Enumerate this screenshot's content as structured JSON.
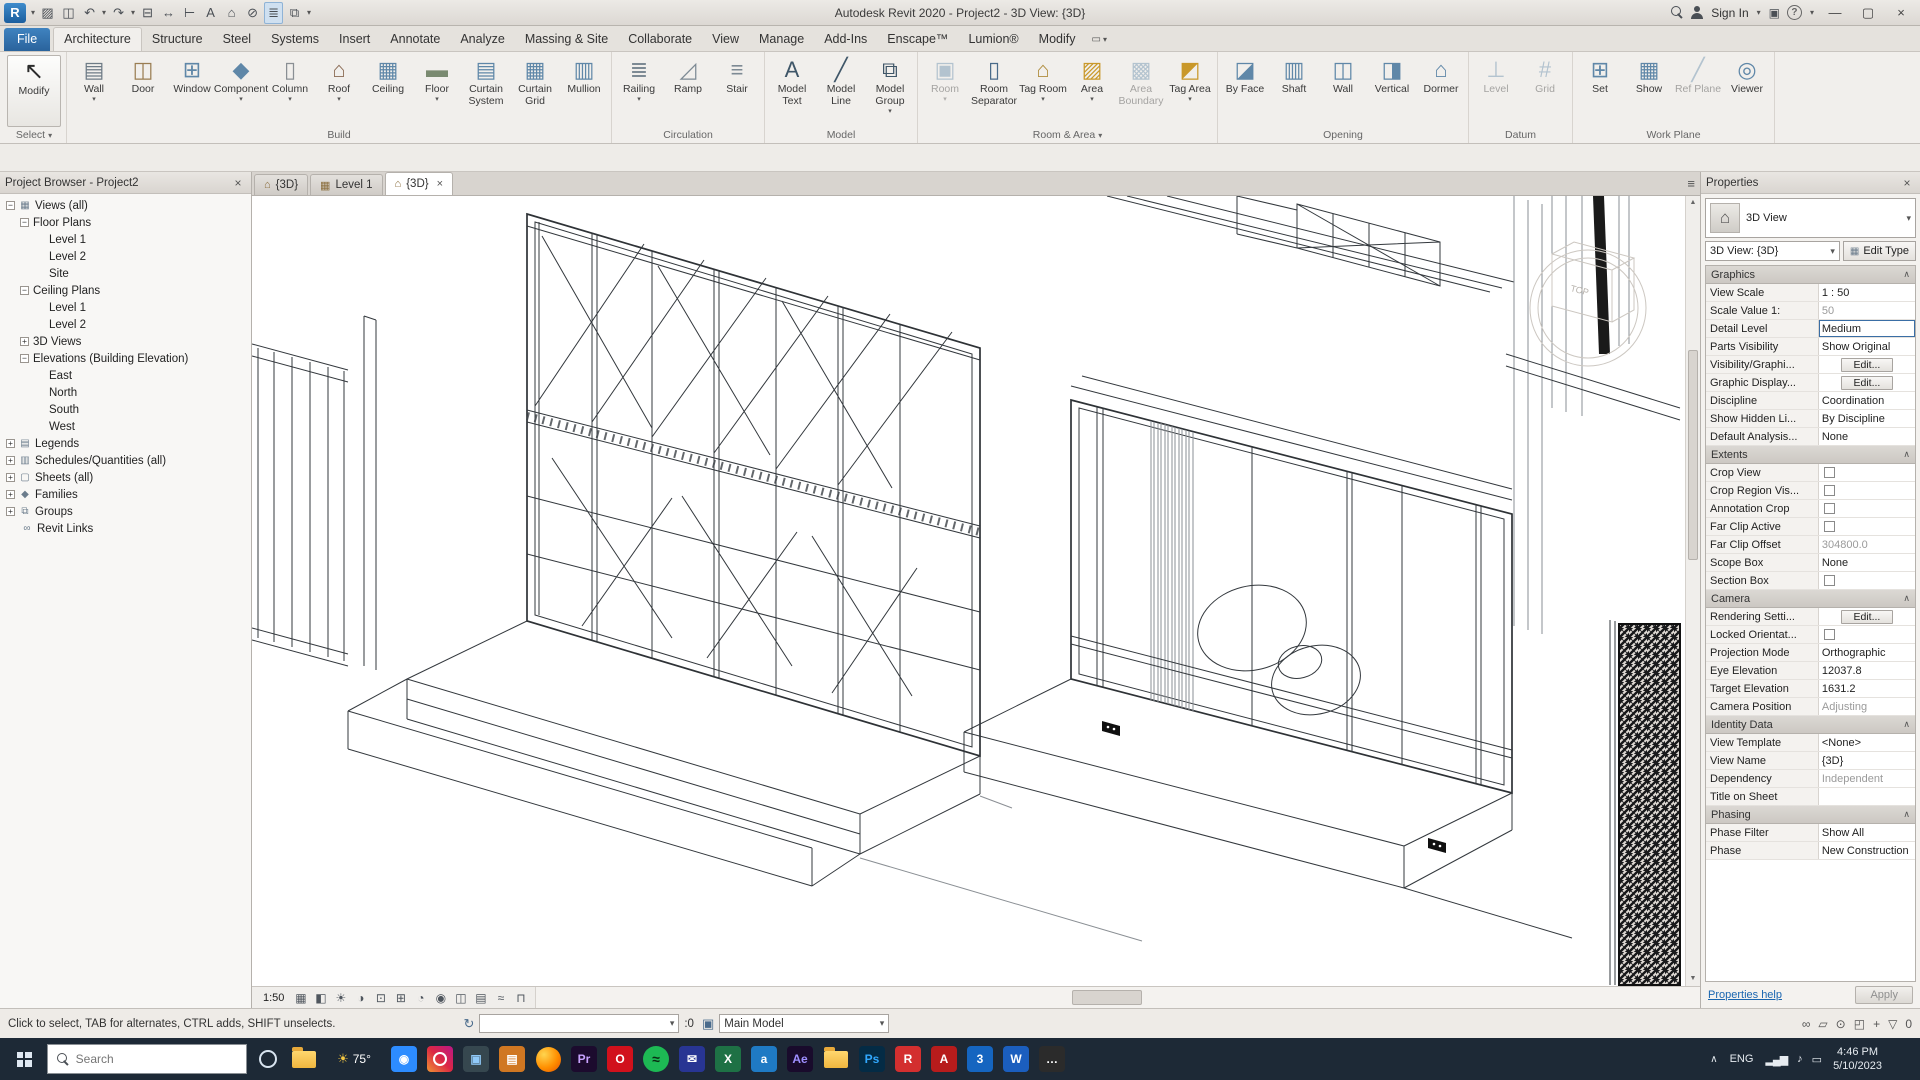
{
  "title_bar": {
    "title": "Autodesk Revit 2020 - Project2 - 3D View: {3D}",
    "sign_in": "Sign In",
    "caret_glyph": "▾",
    "cart_glyph": "▣",
    "help_glyph": "?",
    "min_glyph": "—",
    "restore_glyph": "▢",
    "close_glyph": "×",
    "qat": [
      {
        "name": "revit-logo",
        "glyph": "R"
      },
      {
        "name": "app-menu-caret",
        "glyph": "▾"
      },
      {
        "name": "open-icon",
        "glyph": "▨"
      },
      {
        "name": "save-icon",
        "glyph": "◫"
      },
      {
        "name": "undo-icon",
        "glyph": "↶"
      },
      {
        "name": "undo-caret",
        "glyph": "▾"
      },
      {
        "name": "redo-icon",
        "glyph": "↷"
      },
      {
        "name": "redo-caret",
        "glyph": "▾"
      },
      {
        "name": "print-icon",
        "glyph": "⊟"
      },
      {
        "name": "measure-icon",
        "glyph": "↔"
      },
      {
        "name": "aligned-dimension-icon",
        "glyph": "⊢"
      },
      {
        "name": "text-icon",
        "glyph": "A"
      },
      {
        "name": "default-3d-view-icon",
        "glyph": "⌂"
      },
      {
        "name": "section-icon",
        "glyph": "⊘"
      },
      {
        "name": "thin-lines-icon",
        "glyph": "≣",
        "active": true
      },
      {
        "name": "switch-windows-icon",
        "glyph": "⧉"
      },
      {
        "name": "qat-customize-caret",
        "glyph": "▾"
      }
    ]
  },
  "ribbon": {
    "tabs": [
      {
        "label": "File",
        "file": true
      },
      {
        "label": "Architecture",
        "active": true
      },
      {
        "label": "Structure"
      },
      {
        "label": "Steel"
      },
      {
        "label": "Systems"
      },
      {
        "label": "Insert"
      },
      {
        "label": "Annotate"
      },
      {
        "label": "Analyze"
      },
      {
        "label": "Massing & Site"
      },
      {
        "label": "Collaborate"
      },
      {
        "label": "View"
      },
      {
        "label": "Manage"
      },
      {
        "label": "Add-Ins"
      },
      {
        "label": "Enscape™"
      },
      {
        "label": "Lumion®"
      },
      {
        "label": "Modify"
      }
    ],
    "modify_cluster": {
      "box": "▭",
      "caret": "▾"
    },
    "panels": [
      {
        "label": "Select",
        "caret": true,
        "buttons": [
          {
            "label": "Modify",
            "glyph": "↖",
            "white": true
          }
        ]
      },
      {
        "label": "Build",
        "buttons": [
          {
            "label": "Wall",
            "glyph": "▤",
            "caret": true,
            "color": "#6e7b86"
          },
          {
            "label": "Door",
            "glyph": "◫",
            "color": "#9a7d52"
          },
          {
            "label": "Window",
            "glyph": "⊞",
            "color": "#5f87a8"
          },
          {
            "label": "Component",
            "glyph": "◆",
            "caret": true,
            "color": "#5f87a8"
          },
          {
            "label": "Column",
            "glyph": "▯",
            "caret": true,
            "color": "#8a8f94"
          },
          {
            "label": "Roof",
            "glyph": "⌂",
            "caret": true,
            "color": "#8a6a54"
          },
          {
            "label": "Ceiling",
            "glyph": "▦",
            "color": "#5f87a8"
          },
          {
            "label": "Floor",
            "glyph": "▬",
            "caret": true,
            "color": "#7a8a70"
          },
          {
            "label": "Curtain System",
            "glyph": "▤",
            "color": "#5f87a8"
          },
          {
            "label": "Curtain Grid",
            "glyph": "▦",
            "color": "#5f87a8"
          },
          {
            "label": "Mullion",
            "glyph": "▥",
            "color": "#5f87a8"
          }
        ]
      },
      {
        "label": "Circulation",
        "buttons": [
          {
            "label": "Railing",
            "glyph": "≣",
            "caret": true,
            "color": "#7d8a94"
          },
          {
            "label": "Ramp",
            "glyph": "◿",
            "color": "#7d8a94"
          },
          {
            "label": "Stair",
            "glyph": "≡",
            "color": "#7d8a94"
          }
        ]
      },
      {
        "label": "Model",
        "buttons": [
          {
            "label": "Model Text",
            "glyph": "A",
            "color": "#3f5668"
          },
          {
            "label": "Model Line",
            "glyph": "╱",
            "color": "#3f5668"
          },
          {
            "label": "Model Group",
            "glyph": "⧉",
            "caret": true,
            "color": "#3f5668"
          }
        ]
      },
      {
        "label": "Room & Area",
        "caret": true,
        "buttons": [
          {
            "label": "Room",
            "glyph": "▣",
            "caret": true,
            "disabled": true
          },
          {
            "label": "Room Separator",
            "glyph": "▯",
            "color": "#4a6b8a"
          },
          {
            "label": "Tag Room",
            "glyph": "⌂",
            "caret": true,
            "color": "#b08d3e"
          },
          {
            "label": "Area",
            "glyph": "▨",
            "caret": true,
            "color": "#c9982a"
          },
          {
            "label": "Area Boundary",
            "glyph": "▩",
            "disabled": true
          },
          {
            "label": "Tag Area",
            "glyph": "◩",
            "caret": true,
            "color": "#c9982a"
          }
        ]
      },
      {
        "label": "Opening",
        "buttons": [
          {
            "label": "By Face",
            "glyph": "◪",
            "color": "#5f87a8"
          },
          {
            "label": "Shaft",
            "glyph": "▥",
            "color": "#5f87a8"
          },
          {
            "label": "Wall",
            "glyph": "◫",
            "color": "#5f87a8"
          },
          {
            "label": "Vertical",
            "glyph": "◨",
            "color": "#5f87a8"
          },
          {
            "label": "Dormer",
            "glyph": "⌂",
            "color": "#5f87a8"
          }
        ]
      },
      {
        "label": "Datum",
        "buttons": [
          {
            "label": "Level",
            "glyph": "⊥",
            "disabled": true
          },
          {
            "label": "Grid",
            "glyph": "#",
            "disabled": true
          }
        ]
      },
      {
        "label": "Work Plane",
        "buttons": [
          {
            "label": "Set",
            "glyph": "⊞",
            "color": "#5f87a8"
          },
          {
            "label": "Show",
            "glyph": "▦",
            "color": "#5f87a8"
          },
          {
            "label": "Ref Plane",
            "glyph": "╱",
            "disabled": true
          },
          {
            "label": "Viewer",
            "glyph": "◎",
            "color": "#5f87a8"
          }
        ]
      }
    ]
  },
  "browser": {
    "header": "Project Browser - Project2",
    "close_glyph": "×",
    "items": [
      {
        "d": 0,
        "exp": "-",
        "g": "▦",
        "label": "Views (all)"
      },
      {
        "d": 1,
        "exp": "-",
        "label": "Floor Plans"
      },
      {
        "d": 2,
        "label": "Level 1"
      },
      {
        "d": 2,
        "label": "Level 2"
      },
      {
        "d": 2,
        "label": "Site"
      },
      {
        "d": 1,
        "exp": "-",
        "label": "Ceiling Plans"
      },
      {
        "d": 2,
        "label": "Level 1"
      },
      {
        "d": 2,
        "label": "Level 2"
      },
      {
        "d": 1,
        "exp": "+",
        "label": "3D Views"
      },
      {
        "d": 1,
        "exp": "-",
        "label": "Elevations (Building Elevation)"
      },
      {
        "d": 2,
        "label": "East"
      },
      {
        "d": 2,
        "label": "North"
      },
      {
        "d": 2,
        "label": "South"
      },
      {
        "d": 2,
        "label": "West"
      },
      {
        "d": 0,
        "exp": "+",
        "g": "▤",
        "label": "Legends"
      },
      {
        "d": 0,
        "exp": "+",
        "g": "▥",
        "label": "Schedules/Quantities (all)"
      },
      {
        "d": 0,
        "exp": "+",
        "g": "▢",
        "label": "Sheets (all)"
      },
      {
        "d": 0,
        "exp": "+",
        "g": "◆",
        "label": "Families"
      },
      {
        "d": 0,
        "exp": "+",
        "g": "⧉",
        "label": "Groups"
      },
      {
        "d": 0,
        "g": "∞",
        "label": "Revit Links"
      }
    ]
  },
  "view_tabs": [
    {
      "glyph": "⌂",
      "label": "{3D}"
    },
    {
      "glyph": "▦",
      "label": "Level 1"
    },
    {
      "glyph": "⌂",
      "label": "{3D}",
      "active": true,
      "close": "×"
    }
  ],
  "canvas": {
    "scale": "1:50",
    "tab_list_glyph": "≡",
    "viewcube_label": "TOP",
    "vcb": [
      {
        "name": "detail-level-icon",
        "glyph": "▦"
      },
      {
        "name": "visual-style-icon",
        "glyph": "◧"
      },
      {
        "name": "sun-path-icon",
        "glyph": "☀"
      },
      {
        "name": "shadows-icon",
        "glyph": "◑"
      },
      {
        "name": "crop-view-icon",
        "glyph": "⊡"
      },
      {
        "name": "show-crop-icon",
        "glyph": "⊞"
      },
      {
        "name": "temporary-hide-icon",
        "glyph": "◔"
      },
      {
        "name": "reveal-hidden-icon",
        "glyph": "◉"
      },
      {
        "name": "worksharing-display-icon",
        "glyph": "◫"
      },
      {
        "name": "temporary-view-icon",
        "glyph": "▤"
      },
      {
        "name": "analysis-icon",
        "glyph": "≈"
      },
      {
        "name": "constraints-icon",
        "glyph": "⊓"
      }
    ]
  },
  "properties": {
    "title": "Properties",
    "close_glyph": "×",
    "type_icon_glyph": "⌂",
    "type_name": "3D View",
    "selector": "3D View: {3D}",
    "edit_type": "Edit Type",
    "edit_type_icon": "▦",
    "section_caret": "∧",
    "sections": [
      {
        "header": "Graphics",
        "rows": [
          {
            "label": "View Scale",
            "value": "1 : 50"
          },
          {
            "label": "Scale Value    1:",
            "value": "50",
            "grayed": true
          },
          {
            "label": "Detail Level",
            "value": "Medium",
            "focused": true
          },
          {
            "label": "Parts Visibility",
            "value": "Show Original"
          },
          {
            "label": "Visibility/Graphi...",
            "value": "Edit...",
            "button": true
          },
          {
            "label": "Graphic Display...",
            "value": "Edit...",
            "button": true
          },
          {
            "label": "Discipline",
            "value": "Coordination"
          },
          {
            "label": "Show Hidden Li...",
            "value": "By Discipline"
          },
          {
            "label": "Default Analysis...",
            "value": "None"
          }
        ]
      },
      {
        "header": "Extents",
        "rows": [
          {
            "label": "Crop View",
            "check": true
          },
          {
            "label": "Crop Region Vis...",
            "check": true
          },
          {
            "label": "Annotation Crop",
            "check": true
          },
          {
            "label": "Far Clip Active",
            "check": true
          },
          {
            "label": "Far Clip Offset",
            "value": "304800.0",
            "grayed": true
          },
          {
            "label": "Scope Box",
            "value": "None"
          },
          {
            "label": "Section Box",
            "check": true
          }
        ]
      },
      {
        "header": "Camera",
        "rows": [
          {
            "label": "Rendering Setti...",
            "value": "Edit...",
            "button": true
          },
          {
            "label": "Locked Orientat...",
            "check": true,
            "grayed": true
          },
          {
            "label": "Projection Mode",
            "value": "Orthographic"
          },
          {
            "label": "Eye Elevation",
            "value": "12037.8"
          },
          {
            "label": "Target Elevation",
            "value": "1631.2"
          },
          {
            "label": "Camera Position",
            "value": "Adjusting",
            "grayed": true
          }
        ]
      },
      {
        "header": "Identity Data",
        "rows": [
          {
            "label": "View Template",
            "value": "<None>"
          },
          {
            "label": "View Name",
            "value": "{3D}"
          },
          {
            "label": "Dependency",
            "value": "Independent",
            "grayed": true
          },
          {
            "label": "Title on Sheet",
            "value": ""
          }
        ]
      },
      {
        "header": "Phasing",
        "rows": [
          {
            "label": "Phase Filter",
            "value": "Show All"
          },
          {
            "label": "Phase",
            "value": "New Construction"
          }
        ]
      }
    ],
    "help_link": "Properties help",
    "apply": "Apply"
  },
  "status_bar": {
    "hint": "Click to select, TAB for alternates, CTRL adds, SHIFT unselects.",
    "workset_glyph": "↻",
    "workset_value": "",
    "editable_count": ":0",
    "design_glyph": "▣",
    "design_option": "Main Model",
    "toggles": [
      {
        "name": "select-links-icon",
        "glyph": "∞"
      },
      {
        "name": "select-underlay-icon",
        "glyph": "▱"
      },
      {
        "name": "select-pinned-icon",
        "glyph": "⊙"
      },
      {
        "name": "select-by-face-icon",
        "glyph": "◰"
      },
      {
        "name": "drag-on-selection-icon",
        "glyph": "+"
      }
    ],
    "filter_glyph": "▽",
    "filter_count": "0",
    "caret_glyph": "▾"
  },
  "taskbar": {
    "search_placeholder": "Search",
    "weather": "75°",
    "sun_glyph": "☀",
    "lang": "ENG",
    "time": "4:46 PM",
    "date": "5/10/2023",
    "chevron": "∧",
    "apps": [
      {
        "name": "cortana",
        "kind": "ring"
      },
      {
        "name": "file-explorer",
        "kind": "folder"
      },
      {
        "name": "weather-widget",
        "kind": "weather"
      },
      {
        "name": "camera-app",
        "bg": "#2d8cff",
        "glyph": "◉",
        "fg": "#ffffff"
      },
      {
        "name": "instagram",
        "kind": "instagram"
      },
      {
        "name": "photos-app",
        "bg": "#36474f",
        "glyph": "▣",
        "fg": "#90caf9"
      },
      {
        "name": "impress",
        "bg": "#d07722",
        "glyph": "▤",
        "fg": "#ffffff"
      },
      {
        "name": "firefox",
        "kind": "firefox"
      },
      {
        "name": "premiere",
        "bg": "#1c0b2e",
        "glyph": "Pr",
        "fg": "#c9a3ff"
      },
      {
        "name": "opera",
        "bg": "#d1111c",
        "glyph": "O",
        "fg": "#ffffff"
      },
      {
        "name": "spotify",
        "kind": "spotify"
      },
      {
        "name": "mail-app",
        "bg": "#283593",
        "glyph": "✉",
        "fg": "#ffffff"
      },
      {
        "name": "excel",
        "bg": "#1e7145",
        "glyph": "X",
        "fg": "#ffffff"
      },
      {
        "name": "audible",
        "bg": "#1f7ac4",
        "glyph": "a",
        "fg": "#ffffff"
      },
      {
        "name": "after-effects",
        "bg": "#190b2c",
        "glyph": "Ae",
        "fg": "#9f8fff"
      },
      {
        "name": "downloads-folder",
        "kind": "folder"
      },
      {
        "name": "photoshop",
        "bg": "#042b45",
        "glyph": "Ps",
        "fg": "#31a8ff"
      },
      {
        "name": "r-app",
        "bg": "#d32f2f",
        "glyph": "R",
        "fg": "#ffffff"
      },
      {
        "name": "a-app",
        "bg": "#b71c1c",
        "glyph": "A",
        "fg": "#ffffff"
      },
      {
        "name": "3-app",
        "bg": "#1565c0",
        "glyph": "3",
        "fg": "#ffffff"
      },
      {
        "name": "word",
        "bg": "#1b5ebe",
        "glyph": "W",
        "fg": "#ffffff"
      },
      {
        "name": "chat-app",
        "bg": "#2b2b2b",
        "glyph": "…",
        "fg": "#ffffff"
      }
    ],
    "tray_icons": [
      {
        "name": "network-icon",
        "glyph": "▂▄▆"
      },
      {
        "name": "volume-icon",
        "glyph": "♪"
      },
      {
        "name": "action-center-icon",
        "glyph": "▭"
      }
    ]
  }
}
